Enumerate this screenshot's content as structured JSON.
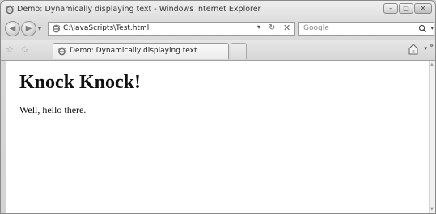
{
  "window": {
    "title": "Demo: Dynamically displaying text - Windows Internet Explorer",
    "min_glyph": "–",
    "max_glyph": "□",
    "close_glyph": "✕"
  },
  "nav": {
    "back_glyph": "◀",
    "forward_glyph": "▶",
    "dropdown_glyph": "▾",
    "address": "C:\\JavaScripts\\Test.html",
    "refresh_glyph": "↻",
    "stop_glyph": "✕",
    "search_placeholder": "Google"
  },
  "tabs": {
    "active_label": "Demo: Dynamically displaying text"
  },
  "page": {
    "heading": "Knock Knock!",
    "paragraph": "Well, hello there."
  },
  "icons": {
    "favorites": "star-icon",
    "add_favorites": "add-favorites-icon",
    "ie": "ie-logo-icon",
    "home": "home-icon",
    "search": "search-icon"
  }
}
